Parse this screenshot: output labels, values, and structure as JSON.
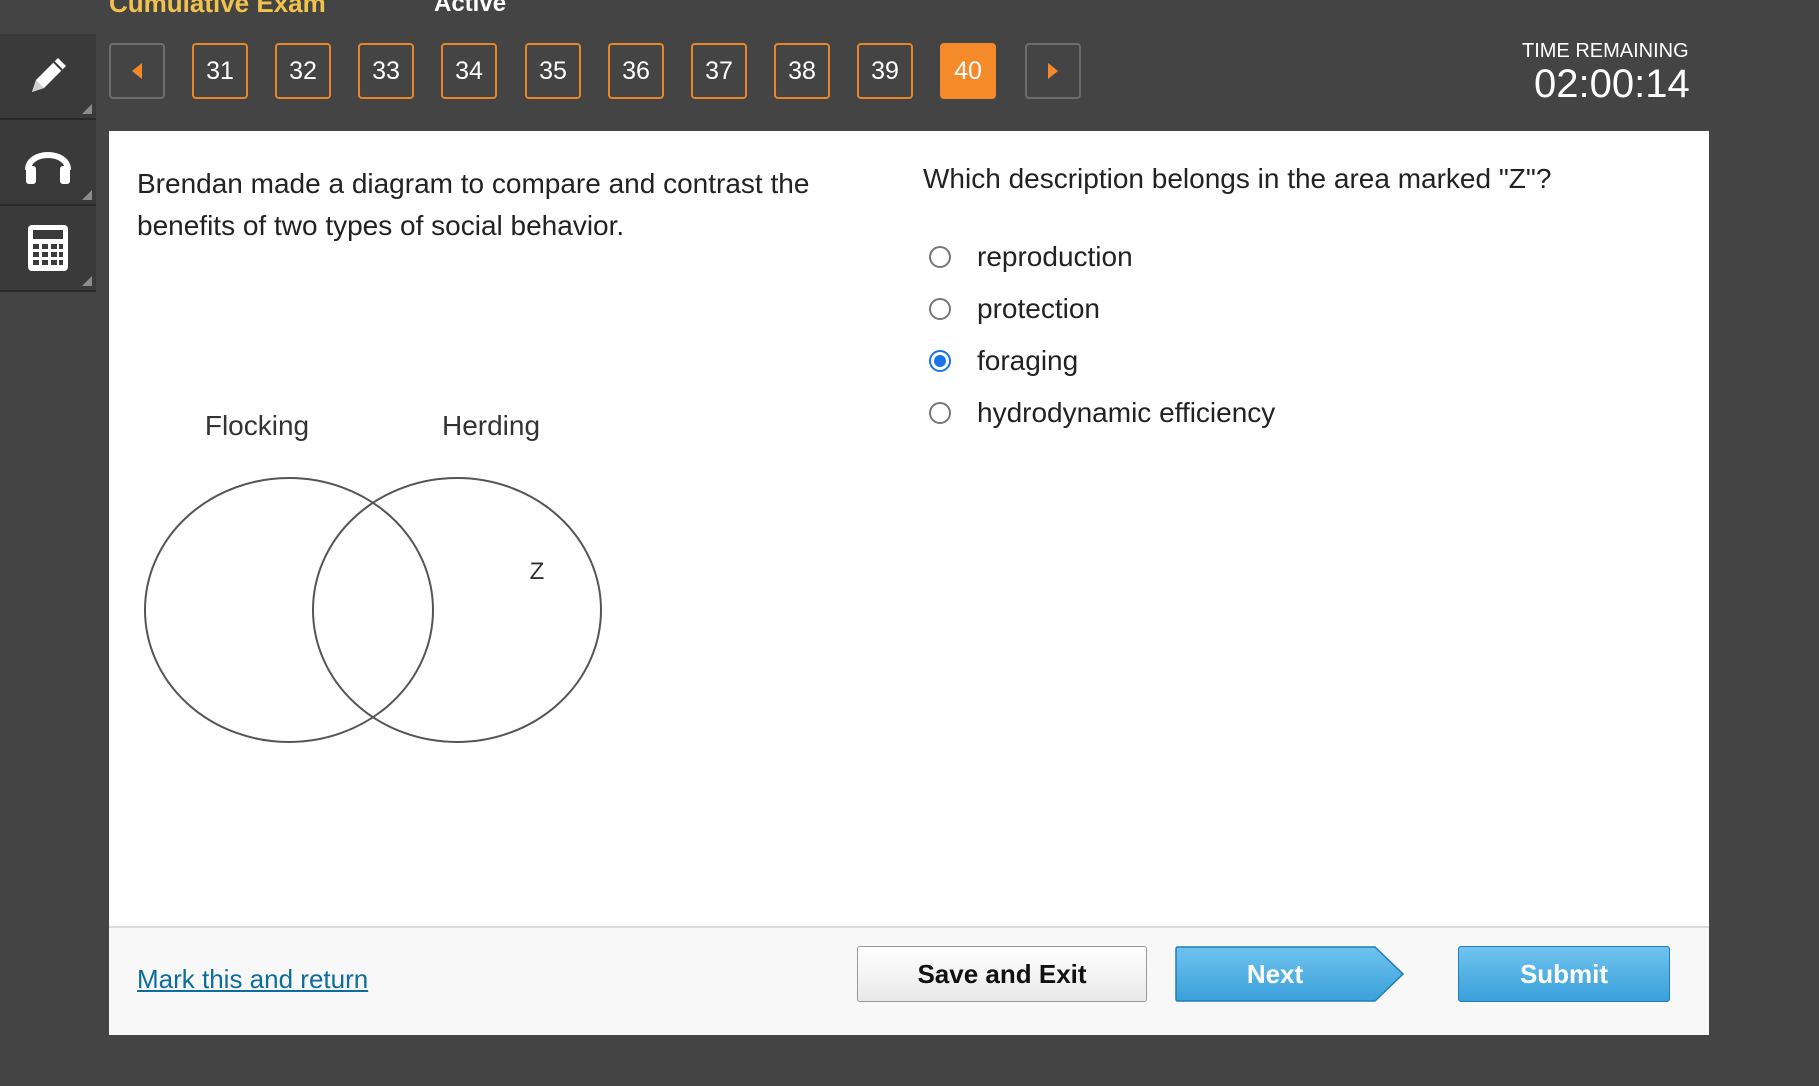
{
  "header": {
    "title": "Cumulative Exam",
    "status": "Active"
  },
  "toolbar": {
    "icons": [
      "pencil-icon",
      "headphones-icon",
      "calculator-icon"
    ]
  },
  "nav": {
    "questions": [
      "31",
      "32",
      "33",
      "34",
      "35",
      "36",
      "37",
      "38",
      "39",
      "40"
    ],
    "current": "40"
  },
  "timer": {
    "label": "TIME REMAINING",
    "value": "02:00:14"
  },
  "passage": {
    "text": "Brendan made a diagram to compare and contrast the benefits of two types of social behavior."
  },
  "diagram": {
    "left_label": "Flocking",
    "right_label": "Herding",
    "marker": "Z"
  },
  "question": {
    "prompt": "Which description belongs in the area marked \"Z\"?",
    "options": [
      {
        "label": "reproduction",
        "selected": false
      },
      {
        "label": "protection",
        "selected": false
      },
      {
        "label": "foraging",
        "selected": true
      },
      {
        "label": "hydrodynamic efficiency",
        "selected": false
      }
    ]
  },
  "footer": {
    "mark_link": "Mark this and return",
    "save_label": "Save and Exit",
    "next_label": "Next",
    "submit_label": "Submit"
  },
  "colors": {
    "accent_orange": "#f58a2a",
    "selected_blue": "#1a73e8",
    "button_blue": "#3aa0da",
    "link_color": "#0d6d9c"
  }
}
